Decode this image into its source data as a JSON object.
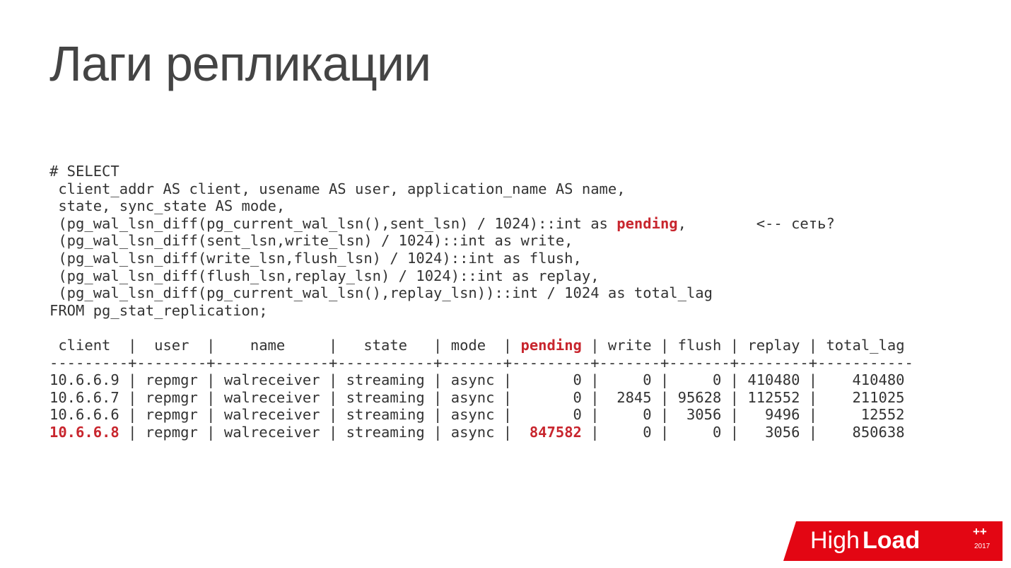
{
  "title": "Лаги репликации",
  "code": {
    "l1": "# SELECT",
    "l2": " client_addr AS client, usename AS user, application_name AS name,",
    "l3": " state, sync_state AS mode,",
    "l4a": " (pg_wal_lsn_diff(pg_current_wal_lsn(),sent_lsn) / 1024)::int as ",
    "l4b": "pending",
    "l4c": ",        <-- сеть?",
    "l5": " (pg_wal_lsn_diff(sent_lsn,write_lsn) / 1024)::int as write,",
    "l6": " (pg_wal_lsn_diff(write_lsn,flush_lsn) / 1024)::int as flush,",
    "l7": " (pg_wal_lsn_diff(flush_lsn,replay_lsn) / 1024)::int as replay,",
    "l8": " (pg_wal_lsn_diff(pg_current_wal_lsn(),replay_lsn))::int / 1024 as total_lag",
    "l9": "FROM pg_stat_replication;",
    "blank": " ",
    "hdrA": " client  |  user  |    name     |   state   | mode  | ",
    "hdrB": "pending",
    "hdrC": " | write | flush | replay | total_lag",
    "sep": "---------+--------+-------------+-----------+-------+---------+-------+-------+--------+-----------",
    "r1": "10.6.6.9 | repmgr | walreceiver | streaming | async |       0 |     0 |     0 | 410480 |    410480",
    "r2": "10.6.6.7 | repmgr | walreceiver | streaming | async |       0 |  2845 | 95628 | 112552 |    211025",
    "r3": "10.6.6.6 | repmgr | walreceiver | streaming | async |       0 |     0 |  3056 |   9496 |     12552",
    "r4a": "10.6.6.8",
    "r4b": " | repmgr | walreceiver | streaming | async |  ",
    "r4c": "847582",
    "r4d": " |     0 |     0 |   3056 |    850638"
  },
  "logo": {
    "text_high": "High",
    "text_load": "Load",
    "plus": "++",
    "year": "2017"
  }
}
